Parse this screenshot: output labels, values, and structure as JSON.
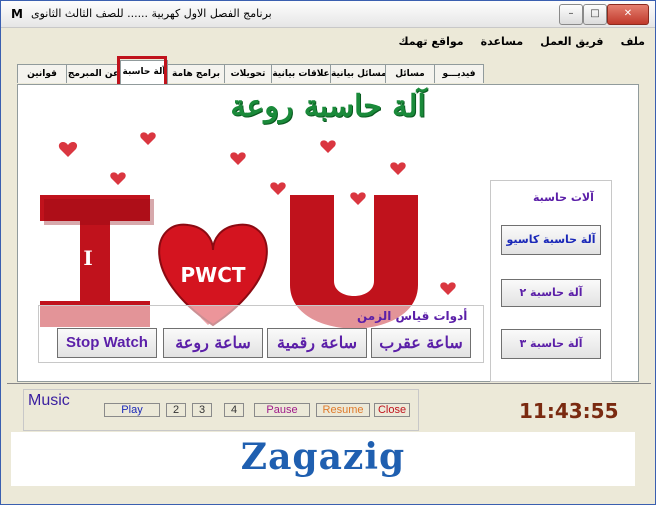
{
  "window": {
    "app_icon": "M",
    "title": "برنامج الفصل الاول كهربية ...... للصف الثالث الثانوى",
    "controls": {
      "minimize": "–",
      "maximize": "□",
      "close": "✕"
    }
  },
  "menu": {
    "items": [
      "ملف",
      "فريق العمل",
      "مساعدة",
      "مواقع تهمك"
    ]
  },
  "tabs": {
    "items": [
      "فيديـــو",
      "مسائل",
      "مسائل بيانية",
      "علاقات بيانية",
      "تحويلات",
      "برامج هامة",
      "آلة حاسبة",
      "عن المبرمج",
      "قوانين"
    ],
    "active": "آلة حاسبة"
  },
  "content": {
    "heading": "آلة حاسبة روعة",
    "art_text": "PWCT",
    "art_letters": {
      "i": "I",
      "u": "U"
    },
    "calculators": {
      "title": "آلات حاسبة",
      "buttons": [
        "آلة حاسبة كاسيو",
        "آلة حاسبة ٢",
        "آلة حاسبة ٣"
      ]
    },
    "time_tools": {
      "title": "أدوات قياس الزمن",
      "buttons": [
        "ساعة عقرب",
        "ساعة رقمية",
        "ساعة روعة",
        "Stop Watch"
      ]
    }
  },
  "music": {
    "label": "Music",
    "buttons": [
      "Play",
      "2",
      "3",
      "4",
      "Pause",
      "Resume",
      "Close"
    ]
  },
  "clock": {
    "time": "11:43:55"
  },
  "footer": {
    "text": "Zagazig"
  },
  "colors": {
    "accent_purple": "#5b1fa8",
    "heading_green": "#1a8a3a",
    "heart_red": "#c0121c",
    "clock_brown": "#7a2a10",
    "footer_blue": "#1f5fb0"
  }
}
